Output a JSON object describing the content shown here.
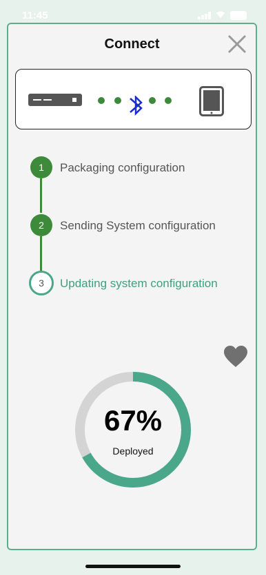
{
  "status_bar": {
    "time": "11:45"
  },
  "dialog": {
    "title": "Connect",
    "close_icon": "close-icon"
  },
  "connection": {
    "left_icon": "server-icon",
    "middle_icon": "bluetooth-icon",
    "right_icon": "tablet-icon",
    "dot_color": "#3c8a3a",
    "bluetooth_color": "#1a2dcc"
  },
  "steps": [
    {
      "number": "1",
      "label": "Packaging configuration",
      "state": "done"
    },
    {
      "number": "2",
      "label": "Sending System configuration",
      "state": "done"
    },
    {
      "number": "3",
      "label": "Updating system configuration",
      "state": "active"
    }
  ],
  "favorite_icon": "heart-icon",
  "progress": {
    "value": 67,
    "percent_text": "67%",
    "caption": "Deployed",
    "color": "#4aa78a",
    "track_color": "#d4d4d4"
  }
}
